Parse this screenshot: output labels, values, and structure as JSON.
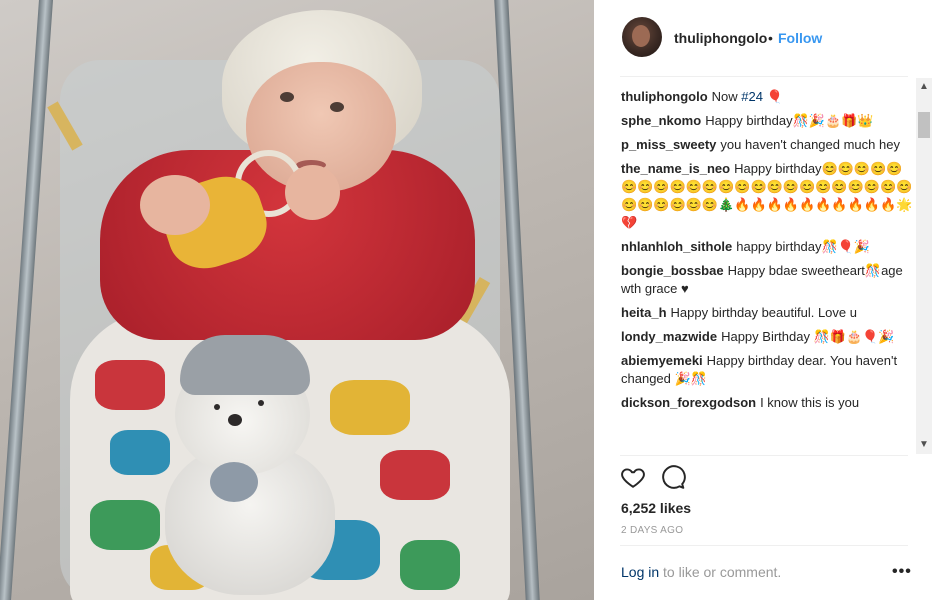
{
  "post": {
    "username": "thuliphongolo",
    "dot": "•",
    "follow_label": "Follow"
  },
  "comments": [
    {
      "user": "thuliphongolo",
      "text": "Now ",
      "tag": "#24",
      "emoji": " 🎈"
    },
    {
      "user": "sphe_nkomo",
      "text": "Happy birthday🎊🎉🎂🎁👑"
    },
    {
      "user": "p_miss_sweety",
      "text": "you haven't changed much hey"
    },
    {
      "user": "the_name_is_neo",
      "text": "Happy birthday😊😊😊😊😊😊😊😊😊😊😊😊😊😊😊😊😊😊😊😊😊😊😊😊😊😊😊😊😊🎄🔥🔥🔥🔥🔥🔥🔥🔥🔥🔥🌟💔"
    },
    {
      "user": "nhlanhloh_sithole",
      "text": "happy birthday🎊🎈🎉"
    },
    {
      "user": "bongie_bossbae",
      "text": "Happy bdae sweetheart🎊age wth grace ♥"
    },
    {
      "user": "heita_h",
      "text": "Happy birthday beautiful. Love u"
    },
    {
      "user": "londy_mazwide",
      "text": "Happy Birthday 🎊🎁🎂🎈🎉"
    },
    {
      "user": "abiemyemeki",
      "text": "Happy birthday dear. You haven't changed 🎉🎊"
    },
    {
      "user": "dickson_forexgodson",
      "text": "I know this is you"
    }
  ],
  "actions": {
    "likes": "6,252 likes",
    "time": "2 DAYS AGO"
  },
  "footer": {
    "login_link": "Log in",
    "login_rest": " to like or comment.",
    "more": "•••"
  },
  "scrollbar": {
    "up": "▲",
    "down": "▼"
  },
  "icons": {
    "like": "heart-outline-icon",
    "comment": "speech-bubble-icon",
    "more": "ellipsis-icon"
  },
  "colors": {
    "link": "#3897f0",
    "text": "#262626",
    "muted": "#999999"
  }
}
